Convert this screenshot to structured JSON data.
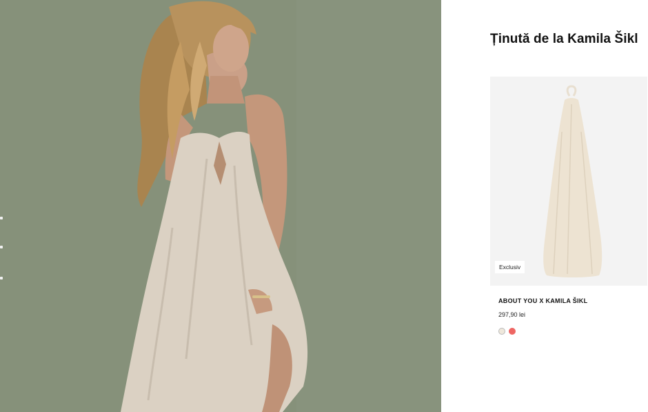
{
  "outfit": {
    "title": "Ținută de la Kamila Šikl"
  },
  "product": {
    "badge": "Exclusiv",
    "brand": "ABOUT YOU X KAMILA ŠIKL",
    "price": "297,90 lei",
    "colors": [
      {
        "name": "cream-swatch",
        "hex": "#efe8dc"
      },
      {
        "name": "coral-swatch",
        "hex": "#ee6663"
      }
    ]
  },
  "colors": {
    "backdrop": "#84907a",
    "dress": "#ddd3c6",
    "hair": "#b9925f",
    "skin": "#c6987d"
  }
}
